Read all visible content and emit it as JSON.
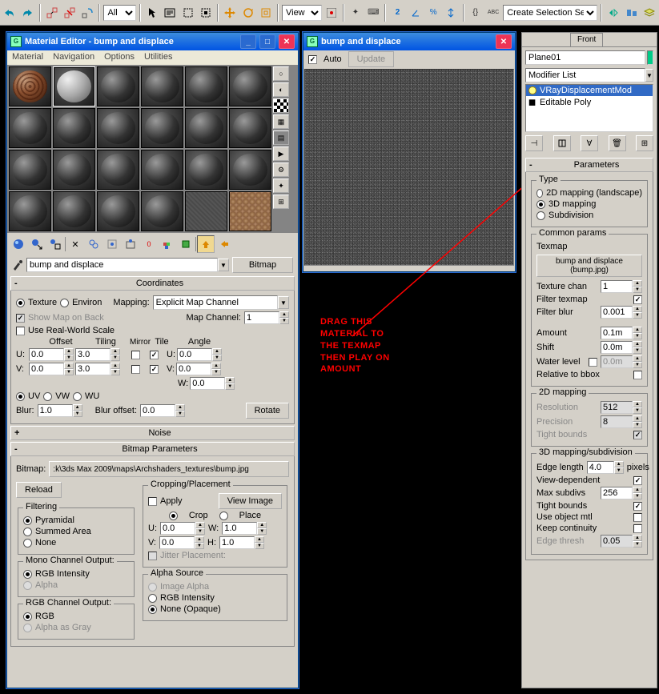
{
  "toolbar": {
    "combo_all": "All",
    "combo_view": "View",
    "combo_selset": "Create Selection Set"
  },
  "matEditor": {
    "title": "Material Editor - bump and displace",
    "menu": {
      "material": "Material",
      "navigation": "Navigation",
      "options": "Options",
      "utilities": "Utilities"
    },
    "name": "bump and displace",
    "type_btn": "Bitmap",
    "coords": {
      "title": "Coordinates",
      "texture": "Texture",
      "environ": "Environ",
      "mapping_lbl": "Mapping:",
      "mapping_val": "Explicit Map Channel",
      "show_map": "Show Map on Back",
      "map_channel_lbl": "Map Channel:",
      "map_channel": "1",
      "real_world": "Use Real-World Scale",
      "hdr_offset": "Offset",
      "hdr_tiling": "Tiling",
      "hdr_mirror": "Mirror",
      "hdr_tile": "Tile",
      "hdr_angle": "Angle",
      "u": "U:",
      "v": "V:",
      "w": "W:",
      "off_u": "0.0",
      "off_v": "0.0",
      "til_u": "3.0",
      "til_v": "3.0",
      "ang_u": "0.0",
      "ang_v": "0.0",
      "ang_w": "0.0",
      "uv": "UV",
      "vw": "VW",
      "wu": "WU",
      "blur_lbl": "Blur:",
      "blur": "1.0",
      "bluroff_lbl": "Blur offset:",
      "bluroff": "0.0",
      "rotate": "Rotate"
    },
    "noise": {
      "title": "Noise"
    },
    "bitmap_params": {
      "title": "Bitmap Parameters",
      "path_lbl": "Bitmap:",
      "path": ":k\\3ds Max 2009\\maps\\Archshaders_textures\\bump.jpg",
      "reload": "Reload",
      "cropping": "Cropping/Placement",
      "apply": "Apply",
      "view": "View Image",
      "crop": "Crop",
      "place": "Place",
      "cu": "0.0",
      "cv": "0.0",
      "cw": "1.0",
      "ch": "1.0",
      "jitter": "Jitter Placement:",
      "filtering": "Filtering",
      "f_pyr": "Pyramidal",
      "f_sa": "Summed Area",
      "f_none": "None",
      "mono": "Mono Channel Output:",
      "m_rgb": "RGB Intensity",
      "m_alpha": "Alpha",
      "alpha_src": "Alpha Source",
      "a_img": "Image Alpha",
      "a_rgb": "RGB Intensity",
      "a_none": "None (Opaque)",
      "rgb_out": "RGB Channel Output:",
      "r_rgb": "RGB",
      "r_gray": "Alpha as Gray"
    }
  },
  "preview": {
    "title": "bump and displace",
    "auto": "Auto",
    "update": "Update"
  },
  "annotation": {
    "l1": "DRAG THIS",
    "l2": "MATERIAL TO",
    "l3": "THE TEXMAP",
    "l4": "THEN PLAY ON",
    "l5": "AMOUNT"
  },
  "modPanel": {
    "tab": "Front",
    "obj_name": "Plane01",
    "modlist": "Modifier List",
    "stack_vray": "VRayDisplacementMod",
    "stack_poly": "Editable Poly",
    "parameters": "Parameters",
    "type_grp": "Type",
    "t_2d": "2D mapping (landscape)",
    "t_3d": "3D mapping",
    "t_sub": "Subdivision",
    "common": "Common params",
    "texmap_lbl": "Texmap",
    "texmap_btn": "bump and displace (bump.jpg)",
    "texchan_lbl": "Texture chan",
    "texchan": "1",
    "filter_tex": "Filter texmap",
    "filter_blur_lbl": "Filter blur",
    "filter_blur": "0.001",
    "amount_lbl": "Amount",
    "amount": "0.1m",
    "shift_lbl": "Shift",
    "shift": "0.0m",
    "water_lbl": "Water level",
    "water": "0.0m",
    "rel_bbox": "Relative to bbox",
    "map2d": "2D mapping",
    "res_lbl": "Resolution",
    "res": "512",
    "prec_lbl": "Precision",
    "prec": "8",
    "tight": "Tight bounds",
    "map3d": "3D mapping/subdivision",
    "edge_lbl": "Edge length",
    "edge": "4.0",
    "pixels": "pixels",
    "viewdep": "View-dependent",
    "maxsub_lbl": "Max subdivs",
    "maxsub": "256",
    "useobj": "Use object mtl",
    "keepcont": "Keep continuity",
    "edgethresh_lbl": "Edge thresh",
    "edgethresh": "0.05"
  }
}
